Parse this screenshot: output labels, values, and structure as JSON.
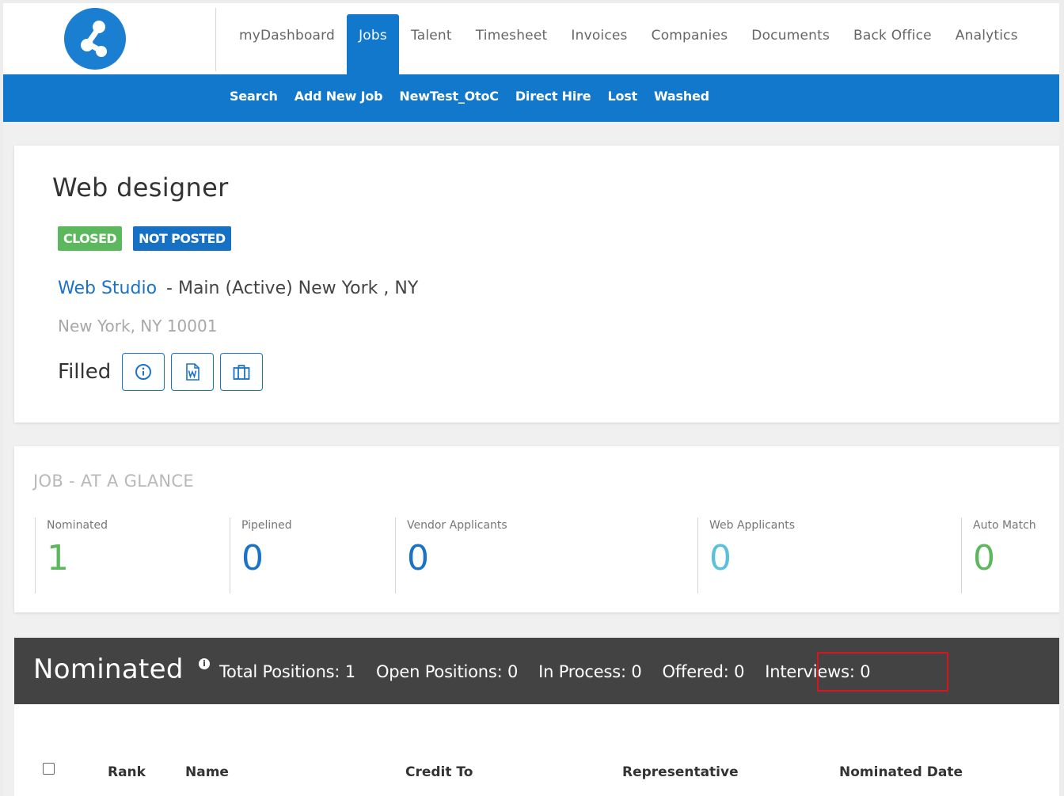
{
  "colors": {
    "brand_blue": "#1278cc",
    "link_blue": "#1a73c7",
    "closed_green": "#5cb85c",
    "not_posted_blue": "#1670c4",
    "dark_bar": "#434343",
    "highlight_red": "#d8151d"
  },
  "nav": {
    "logo_icon": "brand-logo-icon",
    "items": [
      "myDashboard",
      "Jobs",
      "Talent",
      "Timesheet",
      "Invoices",
      "Companies",
      "Documents",
      "Back Office",
      "Analytics"
    ],
    "active": "Jobs"
  },
  "subnav": {
    "items": [
      "Search",
      "Add New Job",
      "NewTest_OtoC",
      "Direct Hire",
      "Lost",
      "Washed"
    ]
  },
  "job": {
    "title": "Web designer",
    "badges": {
      "closed": "CLOSED",
      "not_posted": "NOT POSTED"
    },
    "company": "Web Studio",
    "company_detail": "- Main (Active) New York , NY",
    "address": "New York, NY 10001",
    "status": "Filled",
    "icons": [
      "info-icon",
      "word-document-icon",
      "briefcase-icon"
    ]
  },
  "glance": {
    "title": "JOB - AT A GLANCE",
    "stats": [
      {
        "label": "Nominated",
        "value": "1",
        "color": "#5cb85c"
      },
      {
        "label": "Pipelined",
        "value": "0",
        "color": "#1a73c7"
      },
      {
        "label": "Vendor Applicants",
        "value": "0",
        "color": "#1a73c7"
      },
      {
        "label": "Web Applicants",
        "value": "0",
        "color": "#5bc0de"
      },
      {
        "label": "Auto Match",
        "value": "0",
        "color": "#5cb85c"
      }
    ]
  },
  "nominated": {
    "title": "Nominated",
    "info_glyph": "i",
    "total_positions": "Total Positions: 1",
    "open_positions": "Open Positions: 0",
    "in_process": "In Process: 0",
    "offered": "Offered: 0",
    "interviews": "Interviews: 0"
  },
  "table": {
    "columns": [
      "Rank",
      "Name",
      "Credit To",
      "Representative",
      "Nominated Date"
    ]
  }
}
